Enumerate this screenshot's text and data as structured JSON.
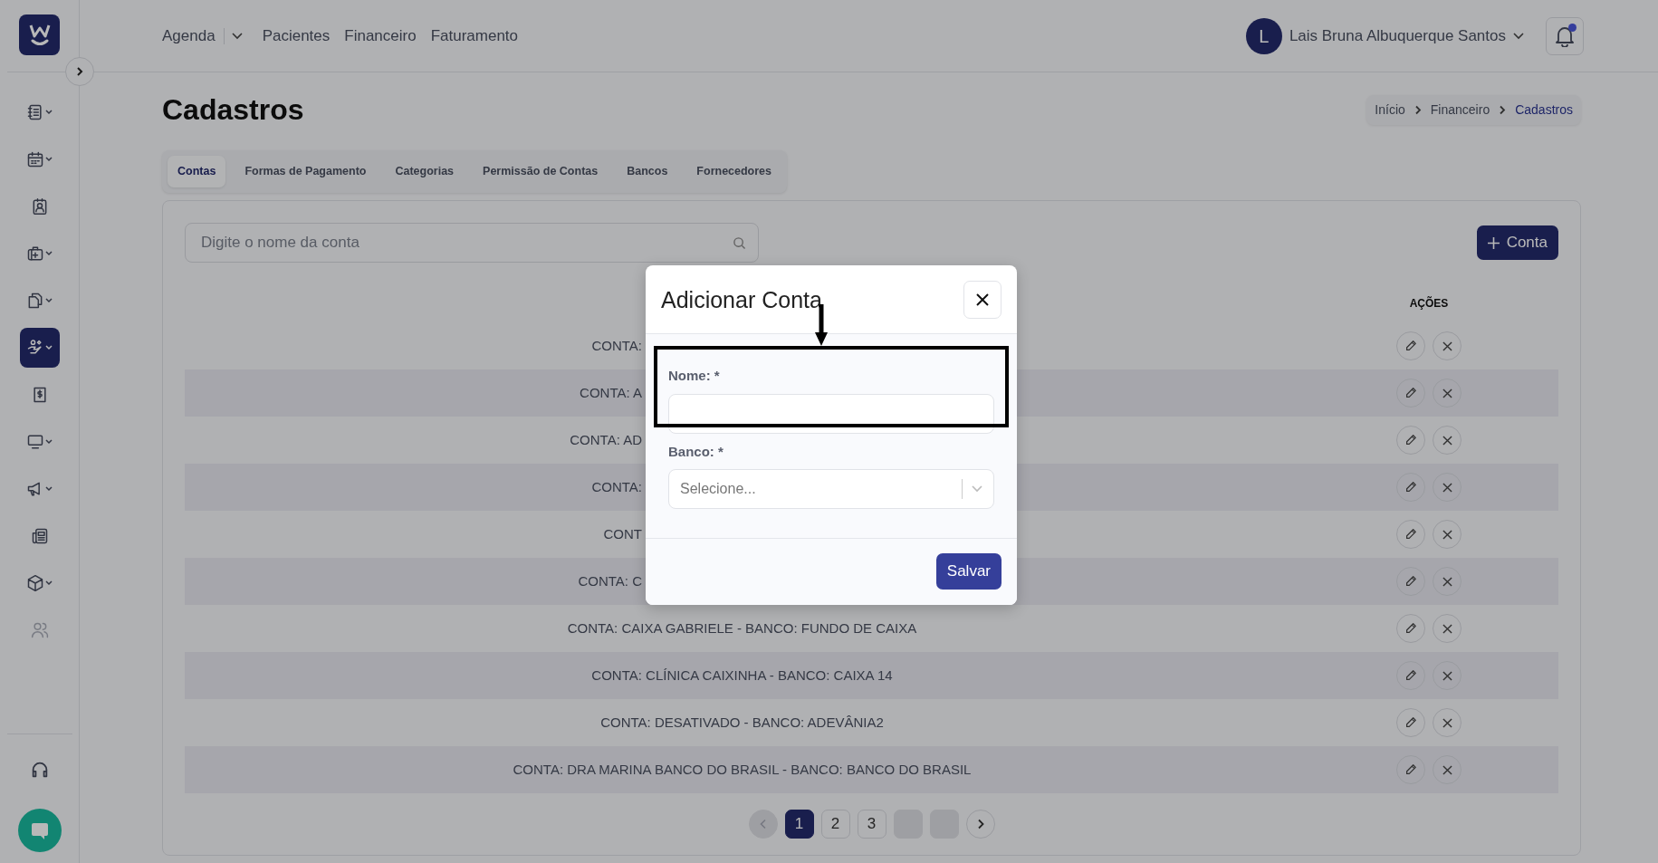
{
  "sidebar": {
    "items": [
      {
        "submenu": true,
        "selected": false,
        "disabled": false
      },
      {
        "submenu": true,
        "selected": false,
        "disabled": false
      },
      {
        "submenu": false,
        "selected": false,
        "disabled": false
      },
      {
        "submenu": true,
        "selected": false,
        "disabled": false
      },
      {
        "submenu": true,
        "selected": false,
        "disabled": false
      },
      {
        "submenu": true,
        "selected": true,
        "disabled": false
      },
      {
        "submenu": false,
        "selected": false,
        "disabled": false
      },
      {
        "submenu": true,
        "selected": false,
        "disabled": false
      },
      {
        "submenu": true,
        "selected": false,
        "disabled": false
      },
      {
        "submenu": false,
        "selected": false,
        "disabled": false
      },
      {
        "submenu": true,
        "selected": false,
        "disabled": false
      },
      {
        "submenu": false,
        "selected": false,
        "disabled": true
      }
    ]
  },
  "nav": {
    "items": [
      {
        "label": "Agenda",
        "dropdown": true
      },
      {
        "label": "Pacientes",
        "dropdown": false
      },
      {
        "label": "Financeiro",
        "dropdown": false
      },
      {
        "label": "Faturamento",
        "dropdown": false
      }
    ]
  },
  "user": {
    "initial": "L",
    "name": "Lais Bruna Albuquerque Santos"
  },
  "notifications": {
    "unread": true
  },
  "page": {
    "title": "Cadastros"
  },
  "breadcrumb": [
    {
      "label": "Início",
      "current": false
    },
    {
      "label": "Financeiro",
      "current": false
    },
    {
      "label": "Cadastros",
      "current": true
    }
  ],
  "tabs": [
    {
      "label": "Contas",
      "selected": true
    },
    {
      "label": "Formas de Pagamento",
      "selected": false
    },
    {
      "label": "Categorias",
      "selected": false
    },
    {
      "label": "Permissão de Contas",
      "selected": false
    },
    {
      "label": "Bancos",
      "selected": false
    },
    {
      "label": "Fornecedores",
      "selected": false
    }
  ],
  "search": {
    "placeholder": "Digite o nome da conta"
  },
  "add_button": {
    "label": "Conta"
  },
  "table": {
    "columns": [
      "AÇÕES"
    ],
    "rows": [
      {
        "kind": "cut",
        "text": "CONTA:"
      },
      {
        "kind": "cut",
        "text": "CONTA: A"
      },
      {
        "kind": "cut",
        "text": "CONTA: AD"
      },
      {
        "kind": "cut",
        "text": "CONTA:"
      },
      {
        "kind": "cut",
        "text": "CONT"
      },
      {
        "kind": "cut",
        "text": "CONTA: C"
      },
      {
        "kind": "full",
        "text": "CONTA: CAIXA GABRIELE - BANCO: FUNDO DE CAIXA"
      },
      {
        "kind": "full",
        "text": "CONTA: CLÍNICA CAIXINHA - BANCO: CAIXA 14"
      },
      {
        "kind": "full",
        "text": "CONTA: DESATIVADO - BANCO: ADEVÂNIA2"
      },
      {
        "kind": "full",
        "text": "CONTA: DRA MARINA BANCO DO BRASIL - BANCO: BANCO DO BRASIL"
      }
    ]
  },
  "pagination": {
    "prev": {
      "disabled": true
    },
    "next": {
      "disabled": false
    },
    "pages": [
      {
        "kind": "number",
        "label": "1",
        "selected": true
      },
      {
        "kind": "number",
        "label": "2",
        "selected": false
      },
      {
        "kind": "number",
        "label": "3",
        "selected": false
      },
      {
        "kind": "blank",
        "selected": false
      },
      {
        "kind": "blank",
        "selected": false
      }
    ]
  },
  "modal": {
    "title": "Adicionar Conta",
    "save": "Salvar",
    "fields": [
      {
        "kind": "text",
        "label": "Nome: *",
        "highlighted": true
      },
      {
        "kind": "select",
        "label": "Banco: *",
        "placeholder": "Selecione...",
        "highlighted": false
      }
    ]
  }
}
